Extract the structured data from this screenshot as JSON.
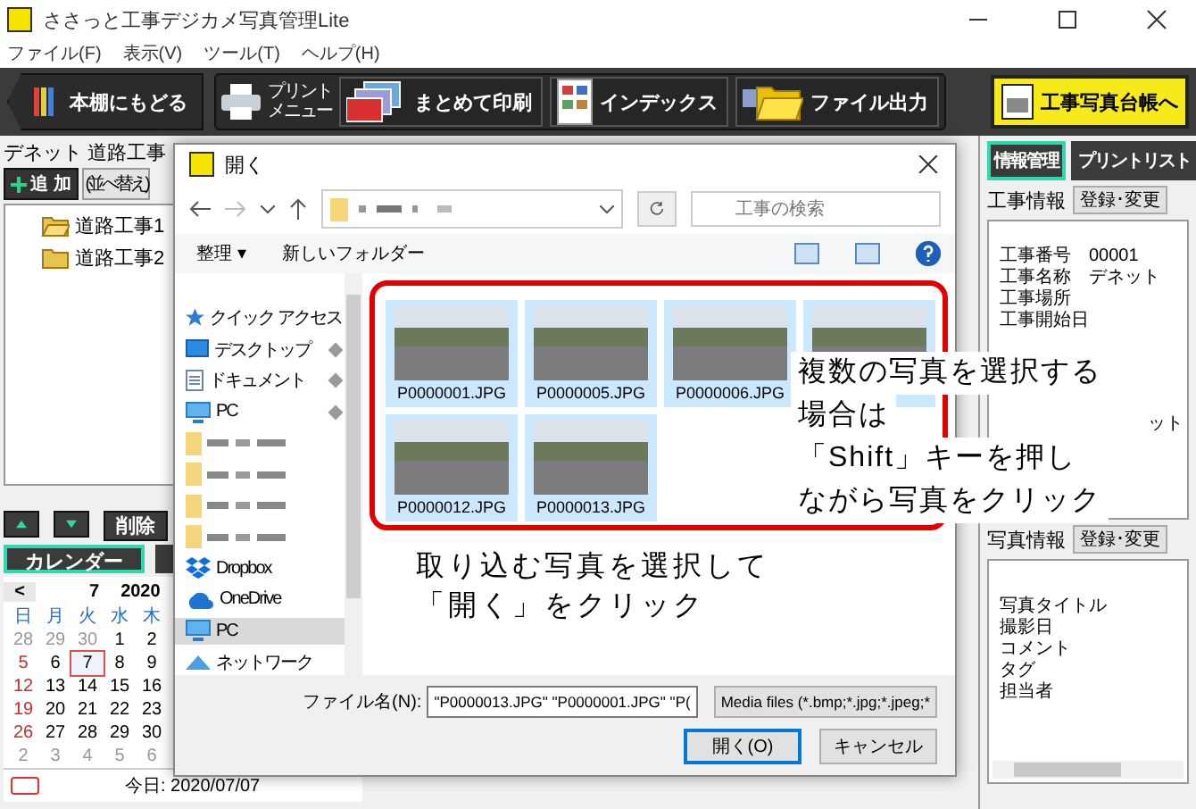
{
  "window": {
    "title": "ささっと工事デジカメ写真管理Lite"
  },
  "menu": [
    "ファイル(F)",
    "表示(V)",
    "ツール(T)",
    "ヘルプ(H)"
  ],
  "toolbar": {
    "back": "本棚にもどる",
    "print_menu": [
      "プリント",
      "メニュー"
    ],
    "buttons": [
      {
        "label": "まとめて印刷",
        "kind": "print"
      },
      {
        "label": "インデックス",
        "kind": "index"
      },
      {
        "label": "ファイル出力",
        "kind": "export"
      }
    ],
    "ledger": "工事写真台帳へ"
  },
  "left": {
    "title": "デネット 道路工事",
    "add": "追 加",
    "sort": "(並べ替え)",
    "tree": [
      {
        "label": "道路工事1",
        "open": true
      },
      {
        "label": "道路工事2",
        "open": false
      }
    ],
    "delete": "削除",
    "tabs": [
      {
        "label": "カレンダー",
        "selected": true
      },
      {
        "selected": false
      }
    ],
    "calendar": {
      "prev": "<",
      "month": "7",
      "year": "2020",
      "weekdays": [
        "日",
        "月",
        "火",
        "水",
        "木"
      ],
      "weeks": [
        [
          {
            "label": "28",
            "kind": "muted"
          },
          {
            "label": "29",
            "kind": "muted"
          },
          {
            "label": "30",
            "kind": "muted"
          },
          {
            "label": "1",
            "kind": "normal"
          },
          {
            "label": "2",
            "kind": "normal"
          }
        ],
        [
          {
            "label": "5",
            "kind": "sunday"
          },
          {
            "label": "6",
            "kind": "normal"
          },
          {
            "label": "7",
            "kind": "normal",
            "selected": true
          },
          {
            "label": "8",
            "kind": "normal"
          },
          {
            "label": "9",
            "kind": "normal"
          }
        ],
        [
          {
            "label": "12",
            "kind": "sunday"
          },
          {
            "label": "13",
            "kind": "normal"
          },
          {
            "label": "14",
            "kind": "normal"
          },
          {
            "label": "15",
            "kind": "normal"
          },
          {
            "label": "16",
            "kind": "normal"
          }
        ],
        [
          {
            "label": "19",
            "kind": "sunday"
          },
          {
            "label": "20",
            "kind": "normal"
          },
          {
            "label": "21",
            "kind": "normal"
          },
          {
            "label": "22",
            "kind": "normal"
          },
          {
            "label": "23",
            "kind": "normal"
          }
        ],
        [
          {
            "label": "26",
            "kind": "sunday"
          },
          {
            "label": "27",
            "kind": "normal"
          },
          {
            "label": "28",
            "kind": "normal"
          },
          {
            "label": "29",
            "kind": "normal"
          },
          {
            "label": "30",
            "kind": "normal"
          }
        ],
        [
          {
            "label": "2",
            "kind": "muted"
          },
          {
            "label": "3",
            "kind": "muted"
          },
          {
            "label": "4",
            "kind": "muted"
          },
          {
            "label": "5",
            "kind": "muted"
          },
          {
            "label": "6",
            "kind": "muted"
          }
        ]
      ]
    },
    "today": "今日: 2020/07/07"
  },
  "right": {
    "tabs": [
      {
        "label": "情報管理",
        "selected": true
      },
      {
        "label": "プリントリスト",
        "selected": false
      }
    ],
    "project": {
      "title": "工事情報",
      "button": "登録･変更",
      "rows": [
        {
          "label": "工事番号",
          "value": "00001"
        },
        {
          "label": "工事名称",
          "value": "デネット"
        },
        {
          "label": "工事場所"
        },
        {
          "label": "工事開始日"
        }
      ],
      "tail": "ット"
    },
    "photo": {
      "title": "写真情報",
      "button": "登録･変更",
      "rows": [
        "写真タイトル",
        "撮影日",
        "コメント",
        "タグ",
        "担当者"
      ]
    }
  },
  "dialog": {
    "title": "開く",
    "search": {
      "placeholder": "工事の検索"
    },
    "organize": "整理 ▾",
    "new_folder": "新しいフォルダー",
    "nav": [
      {
        "label": "クイック アクセス",
        "kind": "star",
        "selected": false
      },
      {
        "label": "デスクトップ",
        "kind": "desktop",
        "pinned": true,
        "selected": false
      },
      {
        "label": "ドキュメント",
        "kind": "document",
        "pinned": true,
        "selected": false
      },
      {
        "label": "PC",
        "kind": "pc",
        "pinned": true,
        "selected": false
      },
      {
        "kind": "folder",
        "selected": false
      },
      {
        "kind": "folder",
        "selected": false
      },
      {
        "kind": "folder",
        "selected": false
      },
      {
        "kind": "folder",
        "selected": false
      },
      {
        "label": "Dropbox",
        "kind": "dropbox",
        "selected": false
      },
      {
        "label": "OneDrive",
        "kind": "cloud",
        "selected": false
      },
      {
        "label": "PC",
        "kind": "pc",
        "selected": true
      },
      {
        "label": "ネットワーク",
        "kind": "network",
        "selected": false
      }
    ],
    "files": [
      {
        "name": "P0000001.JPG",
        "selected": true
      },
      {
        "name": "P0000005.JPG",
        "selected": true
      },
      {
        "name": "P0000006.JPG",
        "selected": true
      },
      {
        "selected": true
      },
      {
        "name": "P0000012.JPG",
        "selected": true
      },
      {
        "name": "P0000013.JPG",
        "selected": true
      }
    ],
    "instruction": [
      "取り込む写真を選択して",
      "「開く」をクリック"
    ],
    "filename_label": "ファイル名(N):",
    "filename": "\"P0000013.JPG\" \"P0000001.JPG\" \"P(",
    "filter": "Media files (*.bmp;*.jpg;*.jpeg;*",
    "open": "開く(O)",
    "cancel": "キャンセル"
  },
  "callout": [
    "複数の写真を選択する",
    "場合は",
    "「Shift」キーを押し",
    "ながら写真をクリック"
  ]
}
